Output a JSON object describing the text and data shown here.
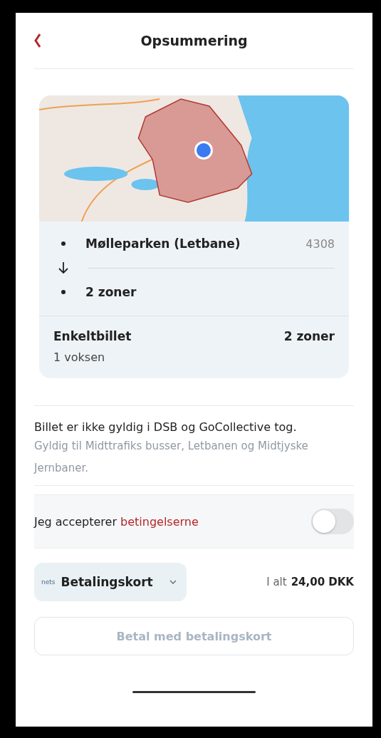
{
  "header": {
    "title": "Opsummering"
  },
  "route": {
    "stops": [
      {
        "name": "Mølleparken (Letbane)",
        "zone": "4308"
      },
      {
        "name": "2 zoner"
      }
    ]
  },
  "ticket": {
    "type": "Enkeltbillet",
    "zones": "2 zoner",
    "passengers": "1 voksen"
  },
  "validity": {
    "notice": "Billet er ikke gyldig i DSB og GoCollective tog.",
    "detail": "Gyldig til Midttrafiks busser, Letbanen og Midtjyske Jernbaner."
  },
  "terms": {
    "label": "Jeg accepterer",
    "link": "betingelserne",
    "on": false
  },
  "payment": {
    "logo": "nets",
    "method": "Betalingskort",
    "total_label": "I alt",
    "total": "24,00 DKK"
  },
  "pay_button": {
    "label": "Betal med betalingskort",
    "disabled": true
  }
}
